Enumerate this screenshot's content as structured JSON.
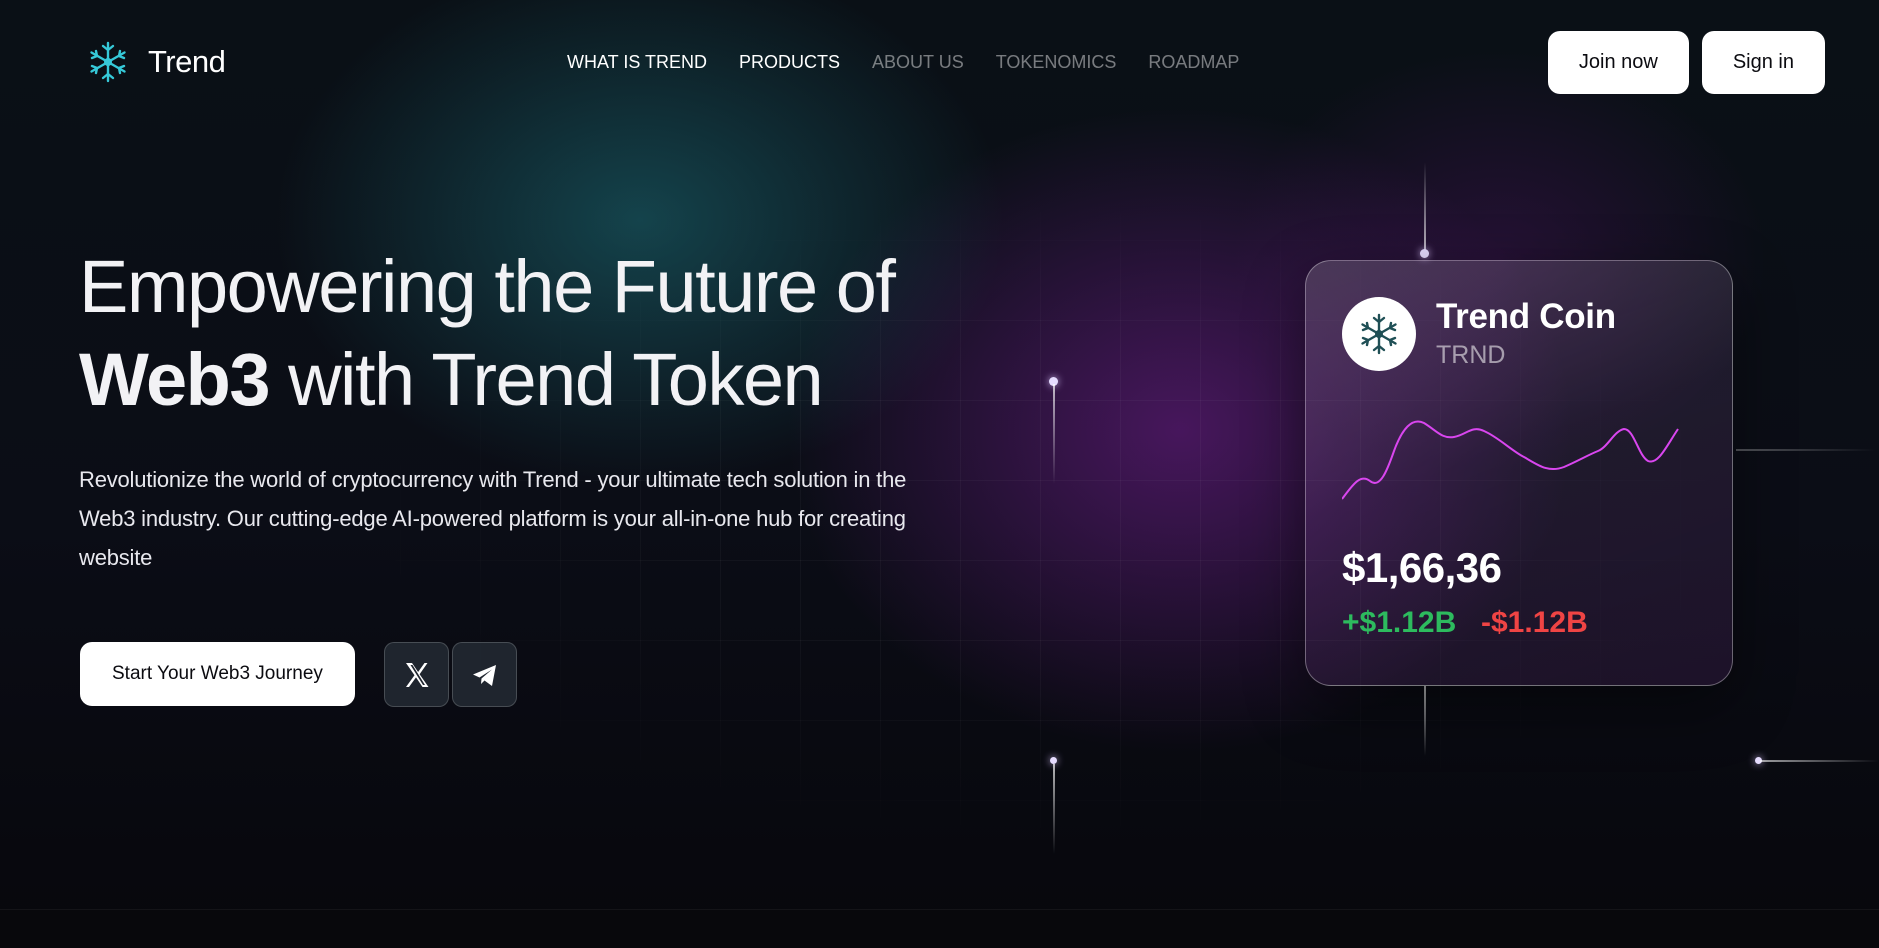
{
  "brand": {
    "name": "Trend",
    "icon": "snowflake-icon",
    "accent": "#36c9d8"
  },
  "nav": {
    "items": [
      {
        "label": "WHAT IS TREND",
        "active": true
      },
      {
        "label": "PRODUCTS",
        "active": true
      },
      {
        "label": "ABOUT US",
        "active": false
      },
      {
        "label": "TOKENOMICS",
        "active": false
      },
      {
        "label": "ROADMAP",
        "active": false
      }
    ]
  },
  "auth": {
    "join_label": "Join now",
    "signin_label": "Sign in"
  },
  "hero": {
    "title_line1": "Empowering the Future of",
    "title_strong": "Web3",
    "title_line2_rest": " with Trend Token",
    "description": "Revolutionize the world of cryptocurrency with Trend - your ultimate tech solution in the Web3 industry. Our cutting-edge AI-powered platform is your all-in-one hub for creating website",
    "cta_label": "Start Your Web3 Journey"
  },
  "social": [
    {
      "name": "x",
      "icon": "x-logo-icon"
    },
    {
      "name": "telegram",
      "icon": "telegram-icon"
    }
  ],
  "coin": {
    "name": "Trend Coin",
    "symbol": "TRND",
    "price": "$1,66,36",
    "change_up": "+$1.12B",
    "change_down": "-$1.12B",
    "sparkline_color": "#d946ef",
    "up_color": "#2dbb5e",
    "down_color": "#ef4444"
  }
}
